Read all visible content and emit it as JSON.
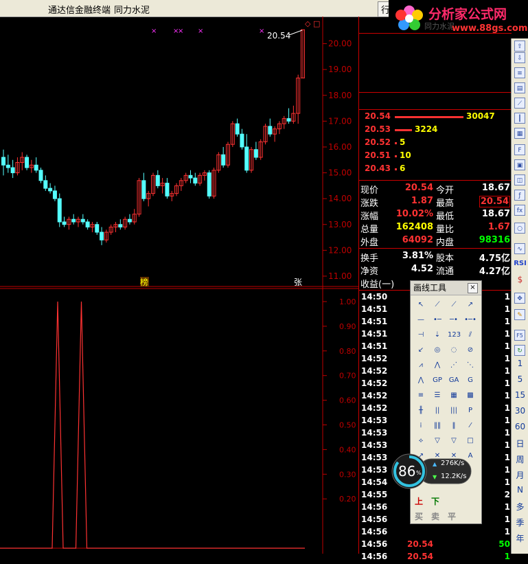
{
  "window": {
    "app_name": "通达信金融终端",
    "stock_name": "同力水泥",
    "menu_fragment": "行"
  },
  "logo": {
    "name": "分析家公式网",
    "url": "www.88gs.com",
    "faded": "同力水泥"
  },
  "colors": {
    "up": "#ff3232",
    "down": "#54ffff",
    "grid": "#c00000",
    "yellow": "#ffff00",
    "white": "#ffffff",
    "green": "#00ff00"
  },
  "main_chart": {
    "last_price_label": "20.54",
    "price_axis": [
      "20.00",
      "19.00",
      "18.00",
      "17.00",
      "16.00",
      "15.00",
      "14.00",
      "13.00",
      "12.00",
      "11.00"
    ],
    "price_range": [
      10.6,
      20.6
    ],
    "markers": [
      "榜",
      "张"
    ],
    "candles": [
      [
        15.6,
        15.9,
        14.9,
        15.3
      ],
      [
        15.3,
        15.7,
        15.0,
        15.2
      ],
      [
        15.2,
        15.5,
        14.8,
        15.0
      ],
      [
        15.0,
        15.6,
        14.9,
        15.4
      ],
      [
        15.4,
        15.8,
        15.1,
        15.6
      ],
      [
        15.6,
        15.7,
        15.1,
        15.2
      ],
      [
        15.2,
        15.5,
        15.0,
        15.3
      ],
      [
        15.3,
        15.6,
        15.0,
        15.1
      ],
      [
        15.1,
        15.2,
        14.6,
        14.7
      ],
      [
        14.7,
        14.9,
        14.3,
        14.4
      ],
      [
        14.4,
        14.6,
        14.2,
        14.3
      ],
      [
        14.3,
        14.5,
        13.9,
        14.0
      ],
      [
        14.0,
        14.2,
        12.9,
        13.1
      ],
      [
        13.1,
        13.3,
        12.9,
        13.0
      ],
      [
        13.0,
        13.3,
        12.8,
        13.2
      ],
      [
        13.2,
        13.4,
        13.0,
        13.1
      ],
      [
        13.1,
        13.3,
        12.9,
        13.2
      ],
      [
        13.2,
        13.4,
        13.0,
        13.1
      ],
      [
        13.1,
        13.2,
        12.8,
        12.9
      ],
      [
        12.9,
        13.1,
        12.7,
        13.0
      ],
      [
        13.0,
        13.1,
        12.6,
        12.7
      ],
      [
        12.7,
        12.9,
        12.2,
        12.4
      ],
      [
        12.4,
        12.8,
        12.3,
        12.7
      ],
      [
        12.7,
        13.0,
        12.6,
        12.9
      ],
      [
        12.9,
        13.1,
        12.7,
        13.0
      ],
      [
        13.0,
        13.2,
        12.8,
        12.9
      ],
      [
        12.9,
        13.3,
        12.8,
        13.2
      ],
      [
        13.2,
        13.4,
        13.0,
        13.1
      ],
      [
        13.1,
        13.6,
        13.0,
        13.4
      ],
      [
        13.4,
        14.8,
        13.3,
        14.7
      ],
      [
        14.7,
        15.0,
        13.9,
        14.0
      ],
      [
        14.0,
        14.3,
        13.7,
        14.2
      ],
      [
        14.2,
        15.0,
        14.1,
        14.9
      ],
      [
        14.9,
        15.1,
        14.4,
        14.5
      ],
      [
        14.5,
        14.8,
        14.2,
        14.6
      ],
      [
        14.6,
        14.8,
        14.0,
        14.1
      ],
      [
        14.1,
        14.3,
        13.9,
        14.2
      ],
      [
        14.2,
        14.6,
        14.1,
        14.5
      ],
      [
        14.5,
        14.8,
        14.3,
        14.7
      ],
      [
        14.7,
        15.0,
        14.6,
        14.9
      ],
      [
        14.9,
        15.1,
        14.6,
        14.8
      ],
      [
        14.8,
        15.0,
        14.5,
        14.6
      ],
      [
        14.6,
        15.0,
        14.5,
        14.9
      ],
      [
        14.9,
        15.1,
        14.7,
        15.0
      ],
      [
        15.0,
        15.1,
        14.0,
        14.1
      ],
      [
        14.1,
        15.2,
        14.0,
        15.1
      ],
      [
        15.1,
        15.8,
        15.0,
        15.7
      ],
      [
        15.7,
        16.0,
        15.2,
        15.3
      ],
      [
        15.3,
        16.2,
        15.2,
        16.1
      ],
      [
        16.1,
        17.0,
        16.0,
        16.9
      ],
      [
        16.9,
        17.1,
        16.4,
        16.5
      ],
      [
        16.5,
        16.7,
        15.9,
        16.0
      ],
      [
        16.0,
        16.5,
        15.0,
        15.1
      ],
      [
        15.1,
        16.0,
        15.0,
        15.9
      ],
      [
        15.9,
        16.2,
        15.5,
        15.6
      ],
      [
        15.6,
        16.3,
        15.5,
        16.2
      ],
      [
        16.2,
        16.9,
        16.1,
        16.8
      ],
      [
        16.8,
        17.1,
        16.4,
        16.5
      ],
      [
        16.5,
        16.8,
        16.2,
        16.7
      ],
      [
        16.7,
        17.0,
        16.5,
        16.9
      ],
      [
        16.9,
        17.2,
        16.7,
        17.1
      ],
      [
        17.1,
        17.5,
        16.9,
        17.0
      ],
      [
        17.0,
        17.6,
        16.9,
        17.3
      ],
      [
        17.3,
        18.8,
        16.9,
        18.67
      ],
      [
        18.67,
        20.54,
        18.67,
        20.54
      ]
    ]
  },
  "indicator": {
    "axis": [
      "1.00",
      "0.90",
      "0.80",
      "0.70",
      "0.60",
      "0.50",
      "0.40",
      "0.30",
      "0.20"
    ],
    "spikes": [
      6,
      9
    ]
  },
  "order_book": [
    {
      "price": "20.54",
      "volume": "30047",
      "bar": 1.0
    },
    {
      "price": "20.53",
      "volume": "3224",
      "bar": 0.25
    },
    {
      "price": "20.52",
      "volume": "5",
      "bar": 0.03
    },
    {
      "price": "20.51",
      "volume": "10",
      "bar": 0.03
    },
    {
      "price": "20.43",
      "volume": "6",
      "bar": 0.03
    }
  ],
  "quote": [
    {
      "l1": "现价",
      "v1": "20.54",
      "l2": "今开",
      "v2": "18.67"
    },
    {
      "l1": "涨跌",
      "v1": "1.87",
      "l2": "最高",
      "v2": "20.54"
    },
    {
      "l1": "涨幅",
      "v1": "10.02%",
      "l2": "最低",
      "v2": "18.67"
    },
    {
      "l1": "总量",
      "v1": "162408",
      "l2": "量比",
      "v2": "1.67"
    },
    {
      "l1": "外盘",
      "v1": "64092",
      "l2": "内盘",
      "v2": "98316"
    },
    {
      "l1": "换手",
      "v1": "3.81%",
      "l2": "股本",
      "v2": "4.75亿"
    },
    {
      "l1": "净资",
      "v1": "4.52",
      "l2": "流通",
      "v2": "4.27亿"
    },
    {
      "l1": "收益(一)",
      "v1": "",
      "l2": "",
      "v2": ""
    }
  ],
  "trades": [
    {
      "t": "14:50",
      "p": "",
      "v": "1"
    },
    {
      "t": "14:51",
      "p": "",
      "v": "1"
    },
    {
      "t": "14:51",
      "p": "",
      "v": "1"
    },
    {
      "t": "14:51",
      "p": "",
      "v": "1"
    },
    {
      "t": "14:51",
      "p": "",
      "v": "1"
    },
    {
      "t": "14:52",
      "p": "",
      "v": "1"
    },
    {
      "t": "14:52",
      "p": "",
      "v": "1"
    },
    {
      "t": "14:52",
      "p": "",
      "v": "1"
    },
    {
      "t": "14:52",
      "p": "",
      "v": "1"
    },
    {
      "t": "14:52",
      "p": "",
      "v": "1"
    },
    {
      "t": "14:53",
      "p": "",
      "v": "1"
    },
    {
      "t": "14:53",
      "p": "",
      "v": "1"
    },
    {
      "t": "14:53",
      "p": "",
      "v": "1"
    },
    {
      "t": "14:53",
      "p": "",
      "v": "1"
    },
    {
      "t": "14:53",
      "p": "",
      "v": "1"
    },
    {
      "t": "14:54",
      "p": "",
      "v": "1"
    },
    {
      "t": "14:55",
      "p": "",
      "v": "2"
    },
    {
      "t": "14:56",
      "p": "",
      "v": "1"
    },
    {
      "t": "14:56",
      "p": "",
      "v": "1"
    },
    {
      "t": "14:56",
      "p": "",
      "v": "1"
    },
    {
      "t": "14:56",
      "p": "20.54",
      "v": "50"
    },
    {
      "t": "14:56",
      "p": "20.54",
      "v": "1"
    }
  ],
  "drawing_panel": {
    "title": "画线工具",
    "close": "×",
    "row_labels": [
      "上",
      "下",
      "买",
      "卖",
      "平"
    ]
  },
  "speed_badge": {
    "percent": "86",
    "unit": "%",
    "up": "276K/s",
    "down": "12.2K/s"
  },
  "toolbar": {
    "periods": [
      "1",
      "5",
      "15",
      "30",
      "60",
      "日",
      "周",
      "月",
      "N",
      "多",
      "季",
      "年"
    ],
    "rsi": "RSI"
  }
}
